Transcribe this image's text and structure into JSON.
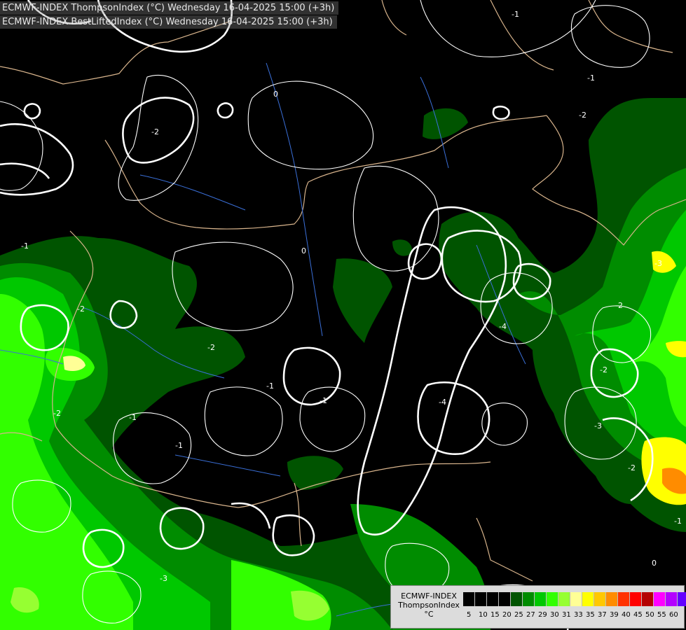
{
  "header": {
    "line1": "ECMWF-INDEX ThompsonIndex (°C) Wednesday 16-04-2025 15:00 (+3h)",
    "line2": "ECMWF-INDEX BestLiftedIndex (°C) Wednesday 16-04-2025 15:00 (+3h)"
  },
  "contour_labels": [
    "-1",
    "-2",
    "0",
    "-1",
    "-2",
    "-3",
    "-4",
    "-2",
    "0",
    "-1",
    "-4",
    "-3",
    "-2",
    "-1",
    "-2",
    "-1",
    "0",
    "-1",
    "-2",
    "-1",
    "-3",
    "-2",
    "-2",
    "-1"
  ],
  "legend": {
    "title_lines": [
      "ECMWF-INDEX",
      "ThompsonIndex",
      "°C"
    ],
    "ticks": [
      "5",
      "10",
      "15",
      "20",
      "25",
      "27",
      "29",
      "30",
      "31",
      "33",
      "35",
      "37",
      "39",
      "40",
      "45",
      "50",
      "55",
      "60"
    ],
    "colors": [
      "#000000",
      "#000000",
      "#000000",
      "#000000",
      "#005400",
      "#008c00",
      "#00c800",
      "#32ff00",
      "#96ff32",
      "#ffff96",
      "#ffff00",
      "#ffc800",
      "#ff8c00",
      "#ff3200",
      "#ff0000",
      "#b40000",
      "#ff00ff",
      "#b400ff",
      "#6400ff",
      "#0000ff"
    ]
  },
  "colors": {
    "background": "#000000",
    "green_dark": "#005400",
    "green_mid": "#008c00",
    "green_bright": "#00c800",
    "green_lime": "#32ff00",
    "yellow": "#ffff00",
    "orange": "#ff8c00",
    "contour": "#ffffff",
    "border": "#d8b48c",
    "river": "#3a6fd8"
  }
}
